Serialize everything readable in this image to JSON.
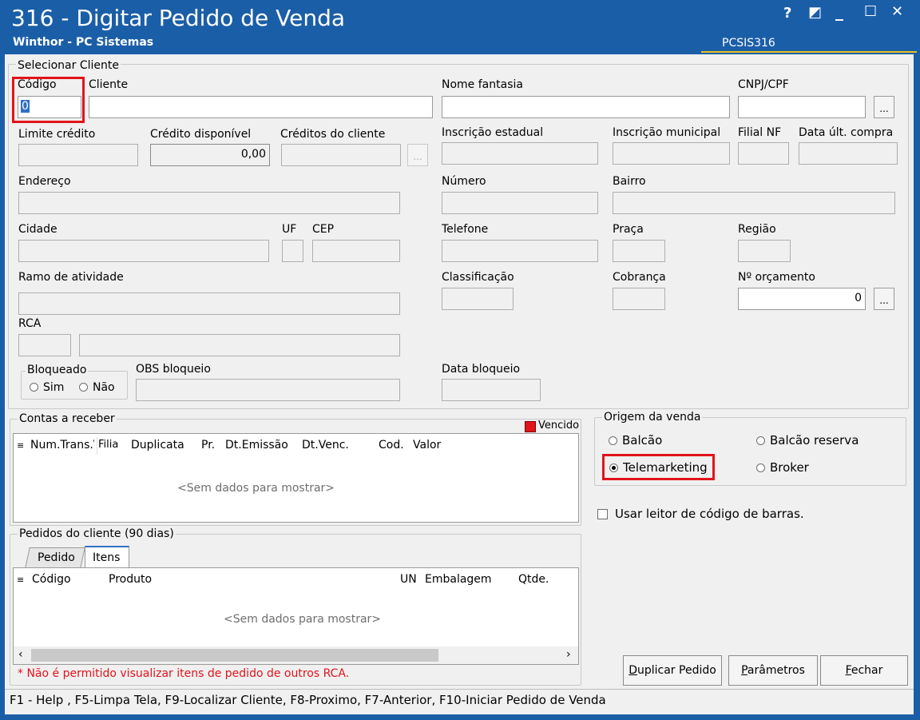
{
  "window": {
    "title": "316 - Digitar Pedido de Venda",
    "subtitle": "Winthor - PC Sistemas",
    "code": "PCSIS316",
    "controls": {
      "help": "?",
      "restore": "◩",
      "minimize": "_",
      "maximize": "☐",
      "close": "✕"
    }
  },
  "cliente": {
    "group_title": "Selecionar Cliente",
    "codigo_label": "Código",
    "codigo_value": "0",
    "cliente_label": "Cliente",
    "nome_fantasia_label": "Nome fantasia",
    "cnpj_label": "CNPJ/CPF",
    "limite_label": "Limite crédito",
    "credito_disp_label": "Crédito disponível",
    "credito_disp_value": "0,00",
    "creditos_cliente_label": "Créditos do cliente",
    "insc_estadual_label": "Inscrição estadual",
    "insc_municipal_label": "Inscrição municipal",
    "filial_nf_label": "Filial NF",
    "data_ult_compra_label": "Data últ. compra",
    "endereco_label": "Endereço",
    "numero_label": "Número",
    "bairro_label": "Bairro",
    "cidade_label": "Cidade",
    "uf_label": "UF",
    "cep_label": "CEP",
    "telefone_label": "Telefone",
    "praca_label": "Praça",
    "regiao_label": "Região",
    "ramo_label": "Ramo de atividade",
    "classificacao_label": "Classificação",
    "cobranca_label": "Cobrança",
    "orcamento_label": "Nº orçamento",
    "orcamento_value": "0",
    "rca_label": "RCA",
    "bloqueado_title": "Bloqueado",
    "sim_label": "Sim",
    "nao_label": "Não",
    "obs_bloqueio_label": "OBS bloqueio",
    "data_bloqueio_label": "Data bloqueio",
    "dots": "..."
  },
  "contas": {
    "group_title": "Contas a receber",
    "legend_vencido": "Vencido",
    "vencido_color": "#e0141b",
    "columns": [
      "Num.Trans.\\",
      "Filia",
      "Duplicata",
      "Pr.",
      "Dt.Emissão",
      "Dt.Venc.",
      "Cod.",
      "Valor"
    ],
    "empty": "<Sem dados para mostrar>"
  },
  "origem": {
    "group_title": "Origem da venda",
    "balcao": "Balcão",
    "balcao_reserva": "Balcão reserva",
    "telemarketing": "Telemarketing",
    "broker": "Broker",
    "selected": "Telemarketing"
  },
  "leitor": {
    "label": "Usar leitor de código de barras."
  },
  "pedidos": {
    "group_title": "Pedidos do cliente (90 dias)",
    "tabs": [
      "Pedido",
      "Itens"
    ],
    "active_tab": "Itens",
    "columns": [
      "Código",
      "Produto",
      "UN",
      "Embalagem",
      "Qtde."
    ],
    "empty": "<Sem dados para mostrar>",
    "warning": "* Não é permitido visualizar itens de pedido de outros RCA."
  },
  "buttons": {
    "duplicar": "Duplicar Pedido",
    "parametros": "Parâmetros",
    "fechar": "Fechar"
  },
  "status_bar": "F1 - Help , F5-Limpa Tela, F9-Localizar Cliente, F8-Proximo, F7-Anterior, F10-Iniciar Pedido de Venda"
}
